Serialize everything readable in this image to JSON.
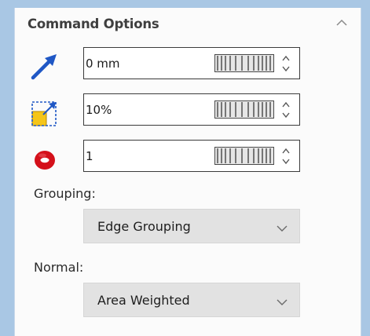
{
  "panel": {
    "title": "Command Options",
    "collapse_icon": "chevron-up-icon"
  },
  "options": [
    {
      "icon": "arrow-distance-icon",
      "value": "0 mm"
    },
    {
      "icon": "scale-box-icon",
      "value": "10%"
    },
    {
      "icon": "ring-count-icon",
      "value": "1"
    }
  ],
  "grouping": {
    "label": "Grouping:",
    "selected": "Edge Grouping"
  },
  "normal": {
    "label": "Normal:",
    "selected": "Area Weighted"
  },
  "colors": {
    "frame": "#a9c7e4",
    "arrow": "#1f57c5",
    "box_fill": "#f5c518",
    "ring": "#d4101a"
  }
}
